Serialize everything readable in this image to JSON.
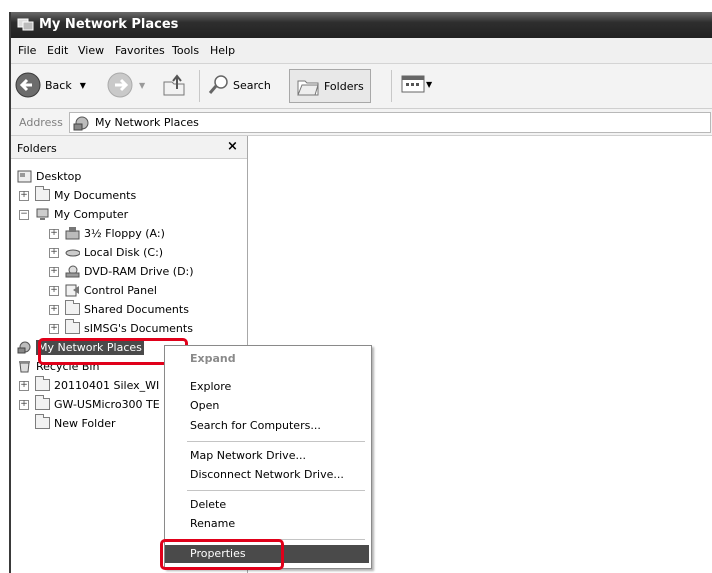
{
  "window": {
    "title": "My Network Places"
  },
  "menu": [
    "File",
    "Edit",
    "View",
    "Favorites",
    "Tools",
    "Help"
  ],
  "toolbar": {
    "back": "Back",
    "search": "Search",
    "folders": "Folders"
  },
  "address": {
    "label": "Address",
    "value": "My Network Places"
  },
  "folders_pane": {
    "title": "Folders",
    "close": "×",
    "tree": [
      "Desktop",
      "My Documents",
      "My Computer",
      "3½ Floppy (A:)",
      "Local Disk (C:)",
      "DVD-RAM Drive (D:)",
      "Control Panel",
      "Shared Documents",
      "sIMSG's Documents",
      "My Network Places",
      "Recycle Bin",
      "20110401 Silex_WI",
      "GW-USMicro300 TE",
      "New Folder"
    ]
  },
  "context_menu": {
    "items": [
      "Expand",
      "Explore",
      "Open",
      "Search for Computers...",
      "Map Network Drive...",
      "Disconnect Network Drive...",
      "Delete",
      "Rename",
      "Properties"
    ]
  },
  "colors": {
    "highlight_box": "#e0001a",
    "selection": "#4a4a4a"
  }
}
